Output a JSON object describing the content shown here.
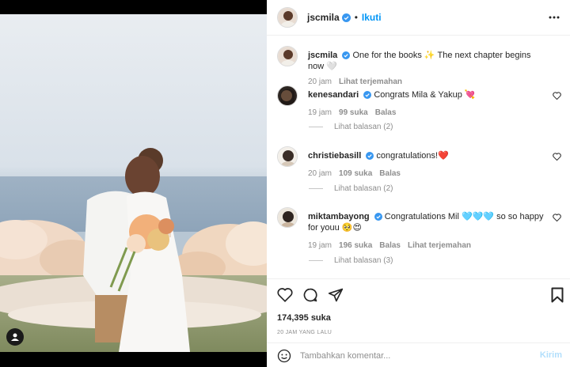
{
  "post": {
    "username": "jscmila",
    "follow_label": "Ikuti",
    "separator": "•",
    "caption": {
      "username": "jscmila",
      "text": "One for the books ✨ The next chapter begins now 🤍",
      "time": "20 jam",
      "translate": "Lihat terjemahan"
    },
    "likes": "174,395 suka",
    "posted_ago": "20 JAM YANG LALU"
  },
  "comments": [
    {
      "username": "kenesandari",
      "text": "Congrats Mila & Yakup 💘",
      "time": "19 jam",
      "likes": "99 suka",
      "reply": "Balas",
      "view_replies": "Lihat balasan (2)"
    },
    {
      "username": "christiebasill",
      "text": "congratulations!❤️",
      "time": "20 jam",
      "likes": "109 suka",
      "reply": "Balas",
      "view_replies": "Lihat balasan (2)"
    },
    {
      "username": "miktambayong",
      "text": "Congratulations Mil 🩵🩵🩵 so so happy for youu 🥺😍",
      "time": "19 jam",
      "likes": "196 suka",
      "reply": "Balas",
      "translate": "Lihat terjemahan",
      "view_replies": "Lihat balasan (3)"
    }
  ],
  "composer": {
    "placeholder": "Tambahkan komentar...",
    "post_label": "Kirim"
  },
  "colors": {
    "accent": "#0095f6",
    "verified": "#3897f0",
    "muted": "#8e8e8e",
    "post_disabled": "#b2dffc"
  },
  "icons": [
    "verified-icon",
    "more-icon",
    "heart-icon",
    "comment-icon",
    "share-icon",
    "bookmark-icon",
    "emoji-icon",
    "user-tag-icon"
  ]
}
